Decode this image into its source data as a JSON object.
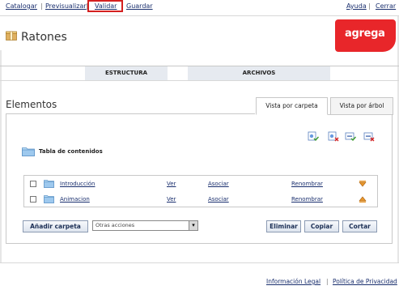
{
  "topnav": {
    "catalogar": "Catalogar",
    "previsualizar": "Previsualizar",
    "validar": "Validar",
    "guardar": "Guardar",
    "ayuda": "Ayuda",
    "cerrar": "Cerrar",
    "separator": "|"
  },
  "header": {
    "title": "Ratones",
    "logo_text": "agrega"
  },
  "main_tabs": {
    "estructura": "ESTRUCTURA",
    "archivos": "ARCHIVOS"
  },
  "elements": {
    "heading": "Elementos",
    "view_tabs": {
      "carpeta": "Vista por carpeta",
      "arbol": "Vista por árbol"
    },
    "toolbar_icons": [
      "add-item-icon",
      "remove-item-icon",
      "expand-icon",
      "collapse-icon"
    ],
    "root_label": "Tabla de contenidos",
    "rows": [
      {
        "name": "Introducción",
        "ver": "Ver",
        "asociar": "Asociar",
        "renombrar": "Renombrar",
        "move_icon": "move-down-icon"
      },
      {
        "name": "Animacion",
        "ver": "Ver",
        "asociar": "Asociar",
        "renombrar": "Renombrar",
        "move_icon": "move-up-icon"
      }
    ],
    "buttons": {
      "anadir": "Añadir carpeta",
      "eliminar": "Eliminar",
      "copiar": "Copiar",
      "cortar": "Cortar"
    },
    "select_value": "Otras acciones"
  },
  "footer": {
    "informacion": "Información Legal",
    "politica": "Política de Privacidad",
    "separator": "|"
  },
  "colors": {
    "link": "#1a2f6e",
    "brand": "#e8262a",
    "highlight_box": "#d42020",
    "folder": "#9ec9ee"
  }
}
